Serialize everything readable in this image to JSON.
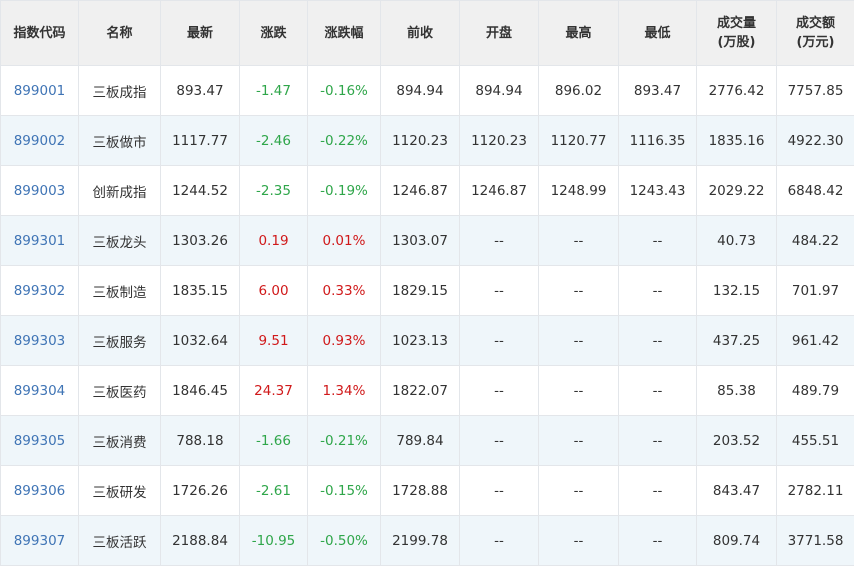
{
  "table": {
    "headers": [
      [
        "指数代码"
      ],
      [
        "名称"
      ],
      [
        "最新"
      ],
      [
        "涨跌"
      ],
      [
        "涨跌幅"
      ],
      [
        "前收"
      ],
      [
        "开盘"
      ],
      [
        "最高"
      ],
      [
        "最低"
      ],
      [
        "成交量",
        "(万股)"
      ],
      [
        "成交额",
        "(万元)"
      ]
    ],
    "rows": [
      {
        "code": "899001",
        "name": "三板成指",
        "last": "893.47",
        "change": "-1.47",
        "pct": "-0.16%",
        "prev": "894.94",
        "open": "894.94",
        "high": "896.02",
        "low": "893.47",
        "volume": "2776.42",
        "amount": "7757.85",
        "direction": "down"
      },
      {
        "code": "899002",
        "name": "三板做市",
        "last": "1117.77",
        "change": "-2.46",
        "pct": "-0.22%",
        "prev": "1120.23",
        "open": "1120.23",
        "high": "1120.77",
        "low": "1116.35",
        "volume": "1835.16",
        "amount": "4922.30",
        "direction": "down"
      },
      {
        "code": "899003",
        "name": "创新成指",
        "last": "1244.52",
        "change": "-2.35",
        "pct": "-0.19%",
        "prev": "1246.87",
        "open": "1246.87",
        "high": "1248.99",
        "low": "1243.43",
        "volume": "2029.22",
        "amount": "6848.42",
        "direction": "down"
      },
      {
        "code": "899301",
        "name": "三板龙头",
        "last": "1303.26",
        "change": "0.19",
        "pct": "0.01%",
        "prev": "1303.07",
        "open": "--",
        "high": "--",
        "low": "--",
        "volume": "40.73",
        "amount": "484.22",
        "direction": "up"
      },
      {
        "code": "899302",
        "name": "三板制造",
        "last": "1835.15",
        "change": "6.00",
        "pct": "0.33%",
        "prev": "1829.15",
        "open": "--",
        "high": "--",
        "low": "--",
        "volume": "132.15",
        "amount": "701.97",
        "direction": "up"
      },
      {
        "code": "899303",
        "name": "三板服务",
        "last": "1032.64",
        "change": "9.51",
        "pct": "0.93%",
        "prev": "1023.13",
        "open": "--",
        "high": "--",
        "low": "--",
        "volume": "437.25",
        "amount": "961.42",
        "direction": "up"
      },
      {
        "code": "899304",
        "name": "三板医药",
        "last": "1846.45",
        "change": "24.37",
        "pct": "1.34%",
        "prev": "1822.07",
        "open": "--",
        "high": "--",
        "low": "--",
        "volume": "85.38",
        "amount": "489.79",
        "direction": "up"
      },
      {
        "code": "899305",
        "name": "三板消费",
        "last": "788.18",
        "change": "-1.66",
        "pct": "-0.21%",
        "prev": "789.84",
        "open": "--",
        "high": "--",
        "low": "--",
        "volume": "203.52",
        "amount": "455.51",
        "direction": "down"
      },
      {
        "code": "899306",
        "name": "三板研发",
        "last": "1726.26",
        "change": "-2.61",
        "pct": "-0.15%",
        "prev": "1728.88",
        "open": "--",
        "high": "--",
        "low": "--",
        "volume": "843.47",
        "amount": "2782.11",
        "direction": "down"
      },
      {
        "code": "899307",
        "name": "三板活跃",
        "last": "2188.84",
        "change": "-10.95",
        "pct": "-0.50%",
        "prev": "2199.78",
        "open": "--",
        "high": "--",
        "low": "--",
        "volume": "809.74",
        "amount": "3771.58",
        "direction": "down"
      }
    ]
  },
  "colors": {
    "up": "#d0191a",
    "down": "#2fa64a",
    "code_link": "#3f74b5",
    "header_bg": "#f0f0f0",
    "stripe_bg": "#eff6fa"
  }
}
